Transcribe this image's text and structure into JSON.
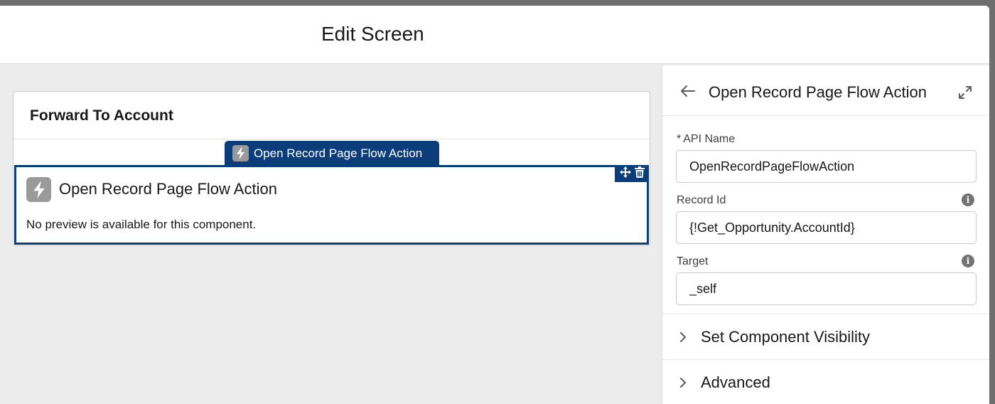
{
  "modal": {
    "title": "Edit Screen"
  },
  "canvas": {
    "section_title": "Forward To Account",
    "component_tab_label": "Open Record Page Flow Action",
    "component": {
      "title": "Open Record Page Flow Action",
      "preview_text": "No preview is available for this component.",
      "icon": "lightning-icon"
    },
    "actions": [
      "move-icon",
      "trash-icon"
    ]
  },
  "panel": {
    "title": "Open Record Page Flow Action",
    "fields": [
      {
        "label": "API Name",
        "required": "*",
        "value": "OpenRecordPageFlowAction",
        "has_info": false
      },
      {
        "label": "Record Id",
        "value": "{!Get_Opportunity.AccountId}",
        "has_info": true
      },
      {
        "label": "Target",
        "value": "_self",
        "has_info": true
      }
    ],
    "sections": [
      {
        "label": "Set Component Visibility"
      },
      {
        "label": "Advanced"
      }
    ]
  },
  "colors": {
    "brand_dark_blue": "#0b3d7a",
    "icon_gray": "#9a9a9a",
    "canvas_bg": "#ececec",
    "backdrop": "#6e6e6e"
  }
}
